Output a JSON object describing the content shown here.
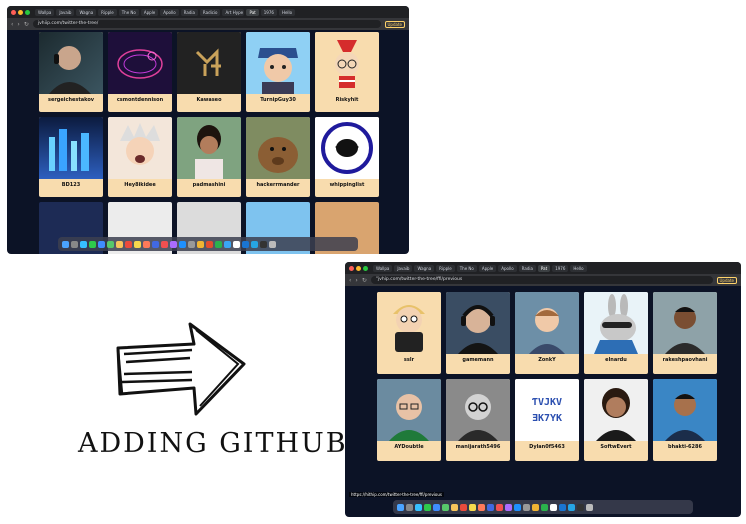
{
  "top_screenshot": {
    "url": "jvhiip.com/twitter-the-tree/",
    "update_label": "Update",
    "tabs": [
      "Wallpa",
      "Javaib",
      "Wagna",
      "Ripple",
      "The No",
      "Apple",
      "Apollo",
      "Radia",
      "Radicio",
      "Art Hype",
      "Pat",
      "1976",
      "Hello"
    ],
    "active_tab": 10,
    "users": [
      "sergeichestakov",
      "csmontdennison",
      "Kawaseo",
      "TurnipGuy30",
      "Riskyhit",
      "BD123",
      "Hey8ikidee",
      "padmashini",
      "hackerrmander",
      "whippinglist"
    ]
  },
  "bottom_screenshot": {
    "url": "\"jvhip.com/twitter-the-tree/ffi/previous",
    "update_label": "Update",
    "status_link": "https://hithip.com/twitter-the-tree/ffi/previous",
    "users": [
      "sslr",
      "gamemann",
      "ZonkY",
      "elnardu",
      "rakeshpaovhani",
      "AYDoubtle",
      "manijarath5496",
      "Dylan0f5463",
      "SoftwEvert",
      "bhakti-6286"
    ]
  },
  "caption": "ADDING GITHUB ID"
}
